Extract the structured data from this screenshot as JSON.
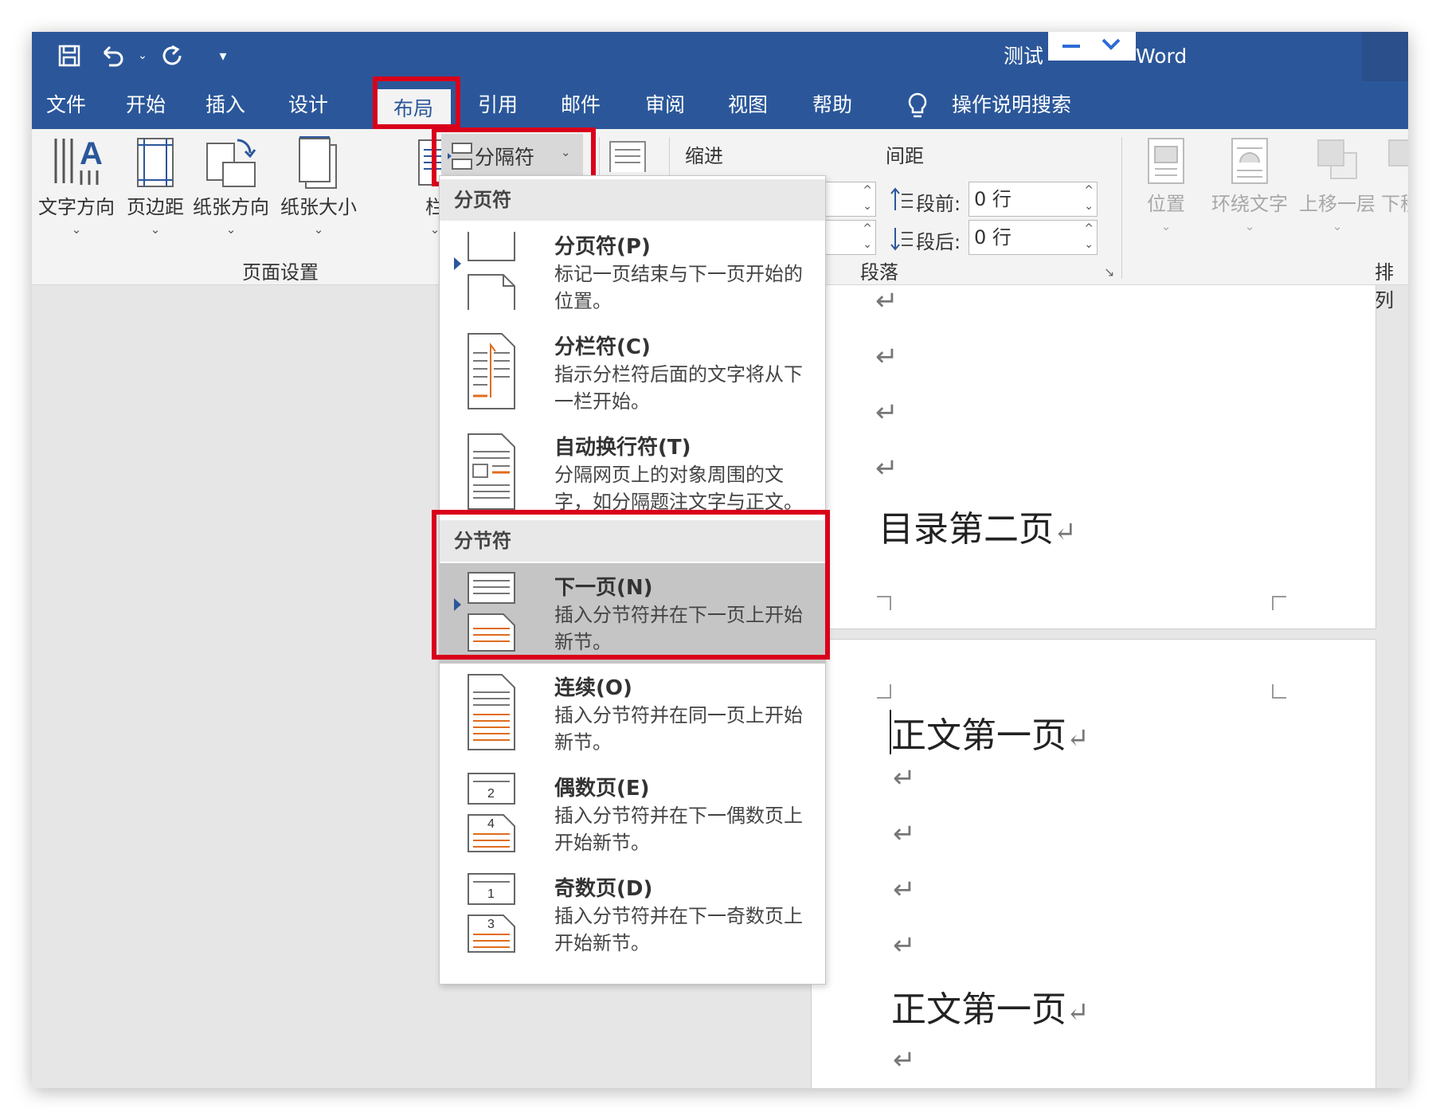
{
  "app": {
    "title": "测试",
    "title_suffix": "Word"
  },
  "tabs": [
    {
      "label": "文件"
    },
    {
      "label": "开始"
    },
    {
      "label": "插入"
    },
    {
      "label": "设计"
    },
    {
      "label": "布局",
      "active": true
    },
    {
      "label": "引用"
    },
    {
      "label": "邮件"
    },
    {
      "label": "审阅"
    },
    {
      "label": "视图"
    },
    {
      "label": "帮助"
    },
    {
      "label": "操作说明搜索",
      "icon": "lightbulb-icon"
    }
  ],
  "ribbon": {
    "page_setup": {
      "label": "页面设置",
      "buttons": [
        {
          "label": "文字方向",
          "icon": "text-direction-icon"
        },
        {
          "label": "页边距",
          "icon": "margins-icon"
        },
        {
          "label": "纸张方向",
          "icon": "orientation-icon"
        },
        {
          "label": "纸张大小",
          "icon": "size-icon"
        },
        {
          "label": "栏",
          "icon": "columns-icon"
        }
      ],
      "breaks_button": "分隔符"
    },
    "paragraph": {
      "label": "段落",
      "indent_label": "缩进",
      "spacing_label": "间距",
      "before_label": "段前:",
      "before_value": "0 行",
      "after_label": "段后:",
      "after_value": "0 行"
    },
    "arrange": {
      "label": "排列",
      "buttons": [
        {
          "label": "位置"
        },
        {
          "label": "环绕文字"
        },
        {
          "label": "上移一层"
        },
        {
          "label": "下移"
        }
      ]
    }
  },
  "breaks_menu": {
    "page_breaks_header": "分页符",
    "section_breaks_header": "分节符",
    "page_breaks": [
      {
        "title": "分页符(P)",
        "desc": "标记一页结束与下一页开始的位置。",
        "icon": "page-break-icon"
      },
      {
        "title": "分栏符(C)",
        "desc": "指示分栏符后面的文字将从下一栏开始。",
        "icon": "column-break-icon"
      },
      {
        "title": "自动换行符(T)",
        "desc": "分隔网页上的对象周围的文字，如分隔题注文字与正文。",
        "icon": "text-wrapping-break-icon"
      }
    ],
    "section_breaks": [
      {
        "title": "下一页(N)",
        "desc": "插入分节符并在下一页上开始新节。",
        "icon": "next-page-section-icon",
        "selected": true
      },
      {
        "title": "连续(O)",
        "desc": "插入分节符并在同一页上开始新节。",
        "icon": "continuous-section-icon"
      },
      {
        "title": "偶数页(E)",
        "desc": "插入分节符并在下一偶数页上开始新节。",
        "icon": "even-page-section-icon",
        "digits": [
          "2",
          "4"
        ]
      },
      {
        "title": "奇数页(D)",
        "desc": "插入分节符并在下一奇数页上开始新节。",
        "icon": "odd-page-section-icon",
        "digits": [
          "1",
          "3"
        ]
      }
    ]
  },
  "document": {
    "page1_heading": "目录第二页",
    "page2_heading1": "正文第一页",
    "page2_heading2": "正文第一页",
    "paragraph_mark": "↵"
  },
  "colors": {
    "title_bar": "#2b579a",
    "highlight": "#d9001b",
    "ribbon": "#f3f3f3",
    "selected_item": "#c5c5c5"
  }
}
